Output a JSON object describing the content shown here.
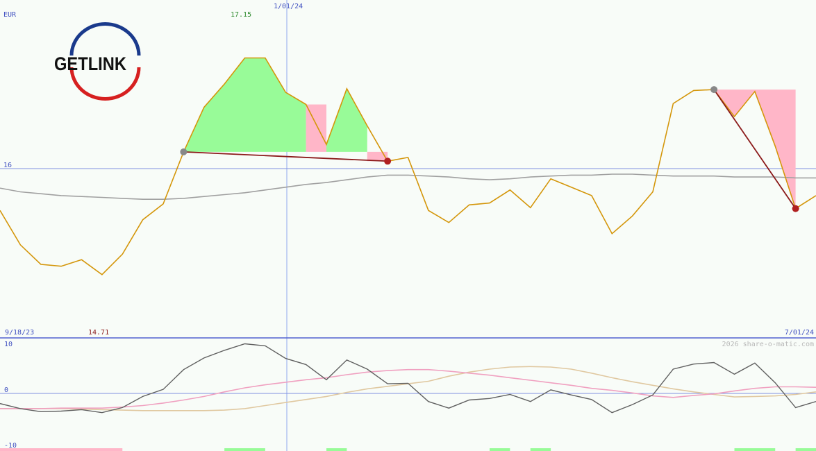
{
  "chart_data": {
    "type": "line",
    "currency_label": "EUR",
    "max_label": "17.15",
    "min_label": "14.71",
    "start_date_label": "9/18/23",
    "mid_date_label": "1/01/24",
    "end_date_label": "7/01/24",
    "ref_level_label": "16",
    "watermark": "2026 share-o-matic.com",
    "colors": {
      "price": "#d4960a",
      "moving_average": "#a0a0a0",
      "trend_line": "#8b1a1a",
      "gain_fill": "#98fb98",
      "loss_fill": "#ffb6c8",
      "grid": "#8090e0",
      "max_label": "#2e8b2e",
      "min_label": "#8b1a1a",
      "axis_text": "#4050c0",
      "osc_main": "#606060",
      "osc_pink": "#f0a0c0",
      "osc_tan": "#e0c8a0"
    },
    "price": [
      15.55,
      15.18,
      14.97,
      14.95,
      15.02,
      14.86,
      15.08,
      15.45,
      15.62,
      16.18,
      16.66,
      16.91,
      17.19,
      17.19,
      16.82,
      16.69,
      16.26,
      16.86,
      16.46,
      16.08,
      16.12,
      15.55,
      15.42,
      15.61,
      15.63,
      15.77,
      15.58,
      15.89,
      15.8,
      15.71,
      15.3,
      15.49,
      15.75,
      16.7,
      16.84,
      16.85,
      16.56,
      16.83,
      16.24,
      15.57,
      15.71
    ],
    "moving_average": [
      15.79,
      15.75,
      15.73,
      15.71,
      15.7,
      15.69,
      15.68,
      15.67,
      15.67,
      15.68,
      15.7,
      15.72,
      15.74,
      15.77,
      15.8,
      15.83,
      15.85,
      15.88,
      15.91,
      15.93,
      15.93,
      15.92,
      15.91,
      15.89,
      15.88,
      15.89,
      15.91,
      15.92,
      15.93,
      15.93,
      15.94,
      15.94,
      15.93,
      15.92,
      15.92,
      15.92,
      15.91,
      15.91,
      15.91,
      15.9,
      15.9
    ],
    "oscillator": {
      "y_max_label": "10",
      "y_zero_label": "0",
      "y_min_label": "-10",
      "main": [
        -2.0,
        -3.0,
        -3.6,
        -3.5,
        -3.2,
        -3.8,
        -2.8,
        -0.6,
        0.8,
        4.7,
        7.0,
        8.5,
        9.8,
        9.4,
        6.9,
        5.7,
        2.7,
        6.6,
        4.8,
        1.9,
        2.0,
        -1.6,
        -2.9,
        -1.3,
        -1.0,
        -0.2,
        -1.6,
        0.7,
        -0.3,
        -1.2,
        -3.8,
        -2.2,
        -0.3,
        4.8,
        5.8,
        6.1,
        3.8,
        6.0,
        2.1,
        -2.8,
        -1.6
      ],
      "signal_pink": [
        -3.0,
        -3.0,
        -3.0,
        -2.9,
        -2.9,
        -2.9,
        -2.7,
        -2.4,
        -1.9,
        -1.3,
        -0.6,
        0.3,
        1.1,
        1.7,
        2.2,
        2.7,
        3.1,
        3.7,
        4.2,
        4.5,
        4.7,
        4.7,
        4.4,
        4.0,
        3.6,
        3.1,
        2.6,
        2.1,
        1.6,
        1.0,
        0.6,
        0.1,
        -0.5,
        -0.8,
        -0.4,
        -0.1,
        0.5,
        1.0,
        1.3,
        1.3,
        1.2
      ],
      "signal_tan": [
        -3.0,
        -3.0,
        -3.0,
        -3.0,
        -3.1,
        -3.2,
        -3.3,
        -3.4,
        -3.4,
        -3.4,
        -3.4,
        -3.3,
        -3.0,
        -2.4,
        -1.8,
        -1.2,
        -0.6,
        0.2,
        0.9,
        1.4,
        1.9,
        2.4,
        3.4,
        4.2,
        4.8,
        5.2,
        5.3,
        5.2,
        4.8,
        4.0,
        3.1,
        2.3,
        1.6,
        0.9,
        0.3,
        -0.2,
        -0.7,
        -0.6,
        -0.5,
        -0.2,
        0.3
      ]
    }
  }
}
